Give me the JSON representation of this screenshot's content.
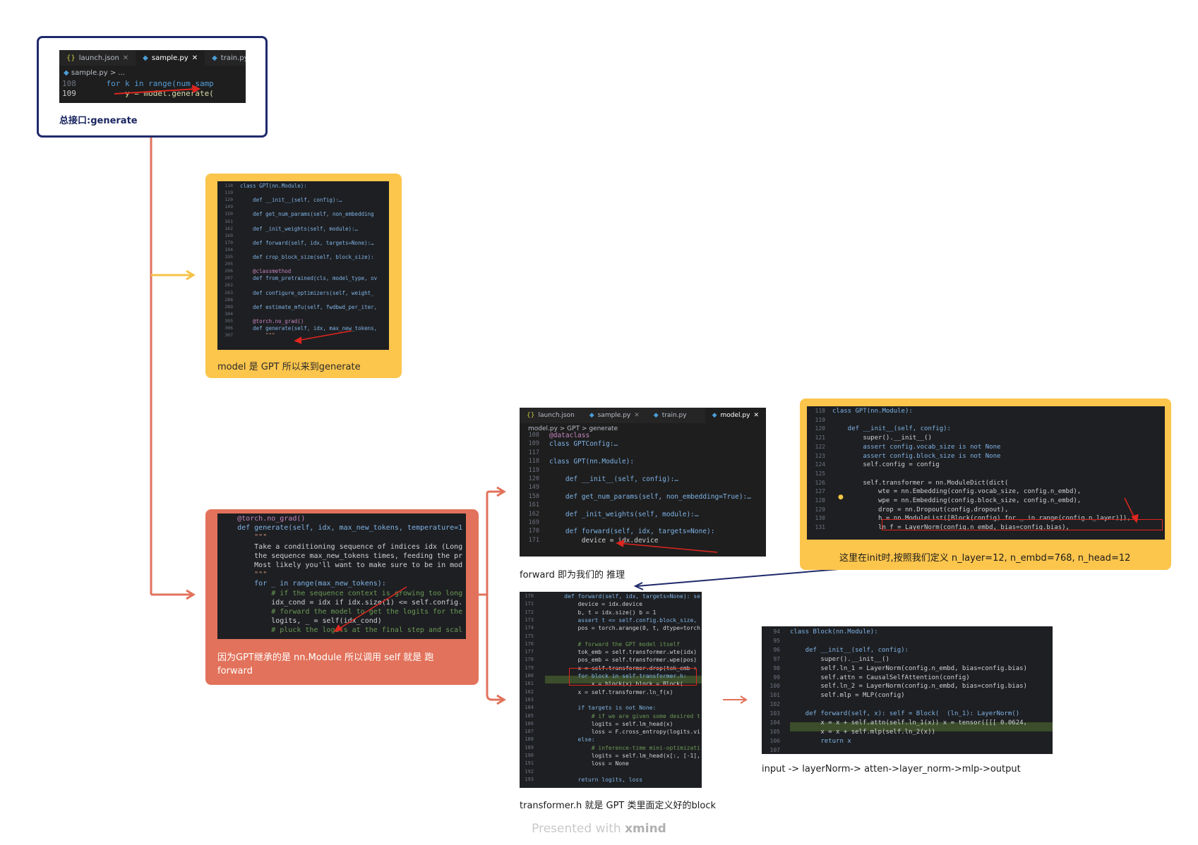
{
  "nodes": {
    "root": {
      "caption": "总接口:generate",
      "tabs": [
        "launch.json",
        "sample.py",
        "train.py"
      ],
      "breadcrumb": "sample.py > ...",
      "lines": [
        "108",
        "109"
      ],
      "code": [
        "    for k in range(num_samp",
        "        y = model.generate("
      ]
    },
    "gpt_class": {
      "caption": "model 是 GPT 所以来到generate",
      "lines": [
        "118",
        "119",
        "120",
        "149",
        "150",
        "161",
        "162",
        "169",
        "170",
        "194",
        "195",
        "205",
        "206",
        "207",
        "262",
        "263",
        "288",
        "289",
        "304",
        "305",
        "306",
        "307"
      ],
      "code": [
        "class GPT(nn.Module):",
        "",
        "    def __init__(self, config):…",
        "",
        "    def get_num_params(self, non_embedding",
        "",
        "    def _init_weights(self, module):…",
        "",
        "    def forward(self, idx, targets=None):…",
        "",
        "    def crop_block_size(self, block_size):",
        "",
        "    @classmethod",
        "    def from_pretrained(cls, model_type, ov",
        "",
        "    def configure_optimizers(self, weight_",
        "",
        "    def estimate_mfu(self, fwdbwd_per_iter,",
        "",
        "    @torch.no_grad()",
        "    def generate(self, idx, max_new_tokens,",
        "        \"\"\""
      ]
    },
    "generate_fn": {
      "caption": "因为GPT继承的是 nn.Module 所以调用 self 就是 跑 forward",
      "code": [
        "    @torch.no_grad()",
        "    def generate(self, idx, max_new_tokens, temperature=1",
        "        \"\"\"",
        "        Take a conditioning sequence of indices idx (Long",
        "        the sequence max_new_tokens times, feeding the pr",
        "        Most likely you'll want to make sure to be in mod",
        "        \"\"\"",
        "        for _ in range(max_new_tokens):",
        "            # if the sequence context is growing too long",
        "            idx_cond = idx if idx.size(1) <= self.config.",
        "            # forward the model to get the logits for the",
        "            logits, _ = self(idx_cond)",
        "            # pluck the logits at the final step and scal"
      ]
    },
    "forward_call": {
      "caption": "forward 即为我们的 推理",
      "tabs": [
        "launch.json",
        "sample.py",
        "train.py",
        "model.py"
      ],
      "breadcrumb": "model.py > GPT > generate",
      "lines": [
        "108",
        "109",
        "117",
        "118",
        "119",
        "120",
        "149",
        "150",
        "161",
        "162",
        "169",
        "170",
        "171"
      ],
      "code": [
        "@dataclass",
        "class GPTConfig:…",
        "",
        "class GPT(nn.Module):",
        "",
        "    def __init__(self, config):…",
        "",
        "    def get_num_params(self, non_embedding=True):…",
        "",
        "    def _init_weights(self, module):…",
        "",
        "    def forward(self, idx, targets=None):",
        "        device = idx.device"
      ]
    },
    "init_def": {
      "caption": "这里在init时,按照我们定义 n_layer=12, n_embd=768, n_head=12",
      "lines": [
        "118",
        "119",
        "120",
        "121",
        "122",
        "123",
        "124",
        "125",
        "126",
        "127",
        "128",
        "129",
        "130",
        "131"
      ],
      "code": [
        "class GPT(nn.Module):",
        "",
        "    def __init__(self, config):",
        "        super().__init__()",
        "        assert config.vocab_size is not None",
        "        assert config.block_size is not None",
        "        self.config = config",
        "",
        "        self.transformer = nn.ModuleDict(dict(",
        "            wte = nn.Embedding(config.vocab_size, config.n_embd),",
        "            wpe = nn.Embedding(config.block_size, config.n_embd),",
        "            drop = nn.Dropout(config.dropout),",
        "            h = nn.ModuleList([Block(config) for _ in range(config.n_layer)]),",
        "            ln_f = LayerNorm(config.n_embd, bias=config.bias),"
      ]
    },
    "forward_def": {
      "caption": "transformer.h 就是 GPT 类里面定义好的block",
      "lines": [
        "170",
        "171",
        "172",
        "173",
        "174",
        "175",
        "176",
        "177",
        "178",
        "179",
        "180",
        "181",
        "182",
        "183",
        "184",
        "185",
        "186",
        "187",
        "188",
        "189",
        "190",
        "191",
        "192",
        "193"
      ],
      "code": [
        "    def forward(self, idx, targets=None): se",
        "        device = idx.device",
        "        b, t = idx.size() b = 1",
        "        assert t <= self.config.block_size,",
        "        pos = torch.arange(0, t, dtype=torch",
        "",
        "        # forward the GPT model itself",
        "        tok_emb = self.transformer.wte(idx)",
        "        pos_emb = self.transformer.wpe(pos)",
        "        x = self.transformer.drop(tok_emb +",
        "        for block in self.transformer.h:",
        "            x = block(x) block = Block(",
        "        x = self.transformer.ln_f(x)",
        "",
        "        if targets is not None:",
        "            # if we are given some desired t",
        "            logits = self.lm_head(x)",
        "            loss = F.cross_entropy(logits.vi",
        "        else:",
        "            # inference-time mini-optimizati",
        "            logits = self.lm_head(x[:, [-1],",
        "            loss = None",
        "",
        "        return logits, loss"
      ]
    },
    "block_def": {
      "caption": "input -> layerNorm-> atten->layer_norm->mlp->output",
      "lines": [
        "94",
        "95",
        "96",
        "97",
        "98",
        "99",
        "100",
        "101",
        "102",
        "103",
        "104",
        "105",
        "106",
        "107"
      ],
      "code": [
        "class Block(nn.Module):",
        "",
        "    def __init__(self, config):",
        "        super().__init__()",
        "        self.ln_1 = LayerNorm(config.n_embd, bias=config.bias)",
        "        self.attn = CausalSelfAttention(config)",
        "        self.ln_2 = LayerNorm(config.n_embd, bias=config.bias)",
        "        self.mlp = MLP(config)",
        "",
        "    def forward(self, x): self = Block(  (ln_1): LayerNorm()",
        "        x = x + self.attn(self.ln_1(x)) x = tensor([[[ 0.0624,",
        "        x = x + self.mlp(self.ln_2(x))",
        "        return x",
        ""
      ]
    }
  },
  "footer": {
    "prefix": "Presented with",
    "brand": "xmind"
  },
  "colors": {
    "root_border": "#1f2a6b",
    "yellow": "#fcc54c",
    "red": "#e2725b",
    "connector_root": "#e2725b",
    "connector_yellow": "#f4c348",
    "connector_red": "#e2725b",
    "connector_blue": "#1f2a6b"
  }
}
